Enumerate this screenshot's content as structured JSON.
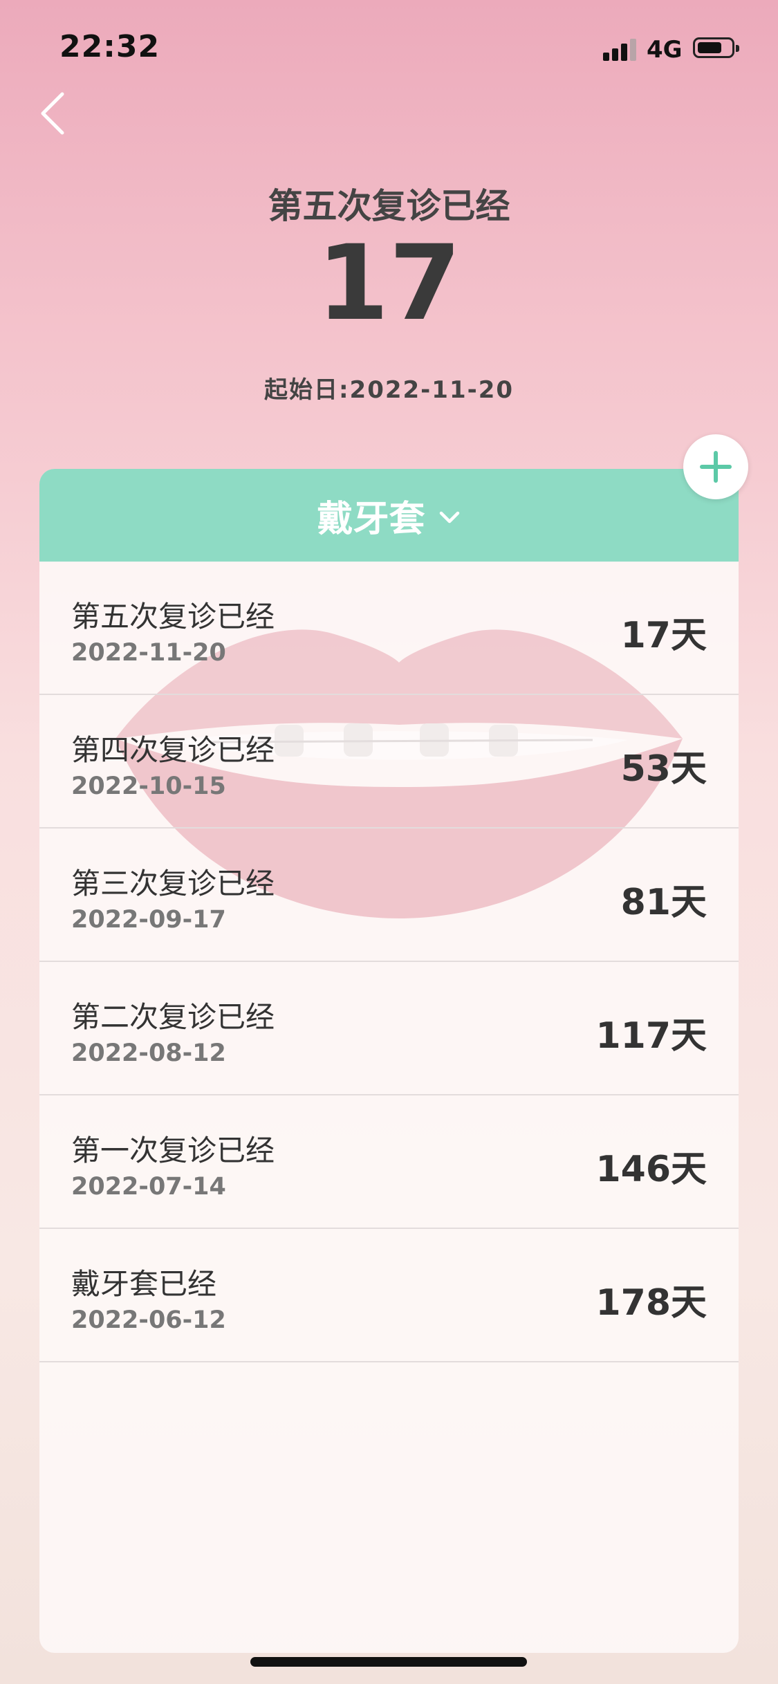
{
  "status_bar": {
    "time": "22:32",
    "network": "4G"
  },
  "header": {
    "title": "第五次复诊已经",
    "days": "17",
    "start_date": "起始日:2022-11-20"
  },
  "card": {
    "category": "戴牙套",
    "records": [
      {
        "title": "第五次复诊已经",
        "date": "2022-11-20",
        "days": "17天"
      },
      {
        "title": "第四次复诊已经",
        "date": "2022-10-15",
        "days": "53天"
      },
      {
        "title": "第三次复诊已经",
        "date": "2022-09-17",
        "days": "81天"
      },
      {
        "title": "第二次复诊已经",
        "date": "2022-08-12",
        "days": "117天"
      },
      {
        "title": "第一次复诊已经",
        "date": "2022-07-14",
        "days": "146天"
      },
      {
        "title": "戴牙套已经",
        "date": "2022-06-12",
        "days": "178天"
      }
    ]
  },
  "icons": {
    "back": "chevron-left-icon",
    "add": "plus-icon",
    "dropdown": "chevron-down-icon"
  },
  "colors": {
    "accent": "#8edbc4",
    "add_icon": "#5cc9a7"
  }
}
